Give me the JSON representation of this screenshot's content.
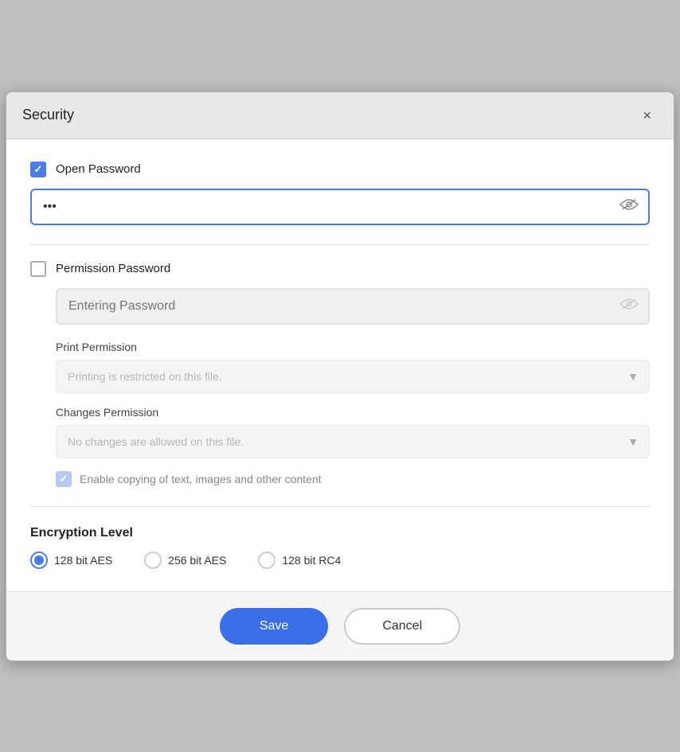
{
  "dialog": {
    "title": "Security",
    "close_label": "×"
  },
  "open_password": {
    "label": "Open Password",
    "checked": true,
    "value": "•••",
    "placeholder": "",
    "eye_icon": "👁"
  },
  "permission_password": {
    "label": "Permission Password",
    "checked": false,
    "placeholder": "Entering Password",
    "eye_icon": "👁"
  },
  "print_permission": {
    "label": "Print Permission",
    "value": "Printing is restricted on this file."
  },
  "changes_permission": {
    "label": "Changes Permission",
    "value": "No changes are allowed on this file."
  },
  "copy_content": {
    "label": "Enable copying of text, images and other content",
    "checked": true
  },
  "encryption": {
    "title": "Encryption Level",
    "options": [
      {
        "label": "128 bit AES",
        "value": "128aes",
        "selected": true
      },
      {
        "label": "256 bit AES",
        "value": "256aes",
        "selected": false
      },
      {
        "label": "128 bit RC4",
        "value": "128rc4",
        "selected": false
      }
    ]
  },
  "footer": {
    "save_label": "Save",
    "cancel_label": "Cancel"
  }
}
